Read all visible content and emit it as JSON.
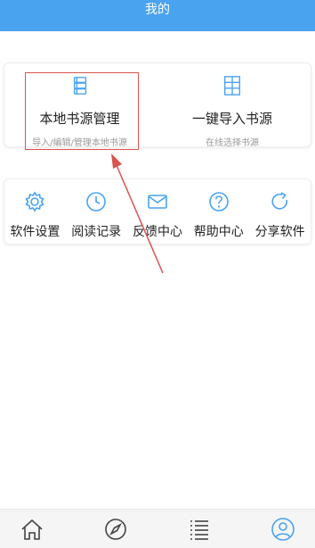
{
  "header": {
    "title": "我的"
  },
  "sources": {
    "local": {
      "title": "本地书源管理",
      "subtitle": "导入/编辑/管理本地书源",
      "icon": "book-stack-icon"
    },
    "import": {
      "title": "一键导入书源",
      "subtitle": "在线选择书源",
      "icon": "grid-document-icon"
    }
  },
  "menu": [
    {
      "label": "软件设置",
      "icon": "gear-icon"
    },
    {
      "label": "阅读记录",
      "icon": "clock-icon"
    },
    {
      "label": "反馈中心",
      "icon": "mail-icon"
    },
    {
      "label": "帮助中心",
      "icon": "question-icon"
    },
    {
      "label": "分享软件",
      "icon": "share-icon"
    }
  ],
  "bottom_nav": [
    {
      "icon": "home-icon"
    },
    {
      "icon": "compass-icon"
    },
    {
      "icon": "list-icon"
    },
    {
      "icon": "user-icon"
    }
  ],
  "colors": {
    "primary": "#4aa3ef",
    "annotation": "#d9534f"
  }
}
